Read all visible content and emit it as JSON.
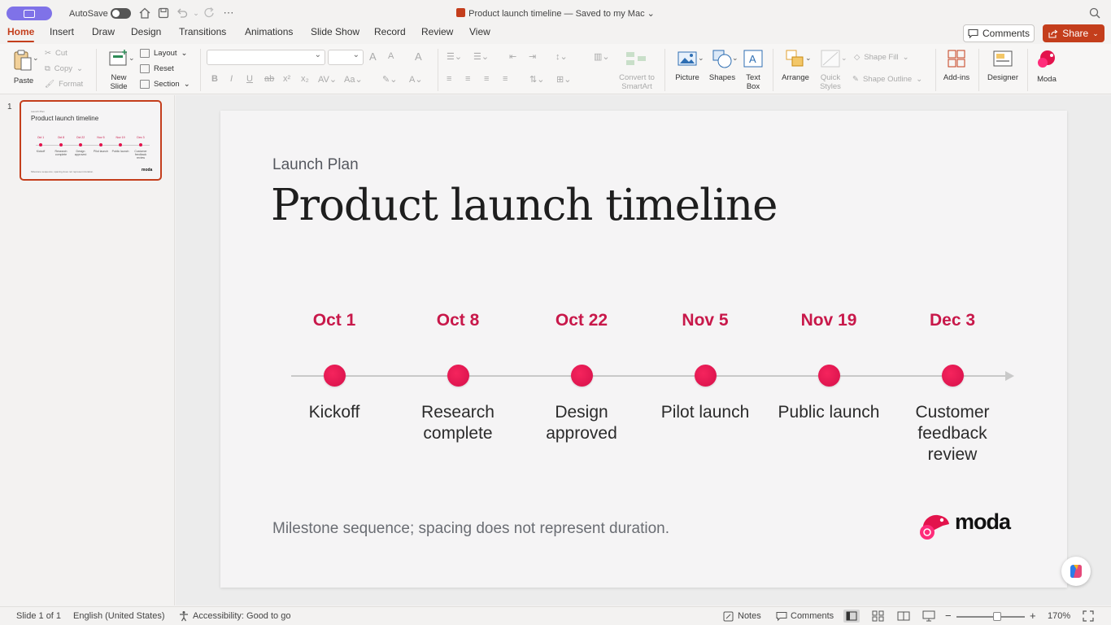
{
  "titlebar": {
    "autosave_label": "AutoSave",
    "doc_title": "Product launch timeline — Saved to my Mac ⌄"
  },
  "tabs": [
    "Home",
    "Insert",
    "Draw",
    "Design",
    "Transitions",
    "Animations",
    "Slide Show",
    "Record",
    "Review",
    "View"
  ],
  "header_buttons": {
    "comments": "Comments",
    "share": "Share"
  },
  "ribbon": {
    "paste": "Paste",
    "cut": "Cut",
    "copy": "Copy",
    "format": "Format",
    "new_slide_1": "New",
    "new_slide_2": "Slide",
    "layout": "Layout",
    "reset": "Reset",
    "section": "Section",
    "convert_1": "Convert to",
    "convert_2": "SmartArt",
    "picture": "Picture",
    "shapes": "Shapes",
    "text_box_1": "Text",
    "text_box_2": "Box",
    "arrange": "Arrange",
    "quick_styles_1": "Quick",
    "quick_styles_2": "Styles",
    "shape_fill": "Shape Fill",
    "shape_outline": "Shape Outline",
    "add_ins": "Add-ins",
    "designer": "Designer",
    "moda": "Moda"
  },
  "thumbnails": {
    "slide_number": "1"
  },
  "slide": {
    "eyebrow": "Launch Plan",
    "title": "Product launch timeline",
    "milestones": [
      {
        "date": "Oct 1",
        "label": "Kickoff"
      },
      {
        "date": "Oct 8",
        "label": "Research complete"
      },
      {
        "date": "Oct 22",
        "label": "Design approved"
      },
      {
        "date": "Nov 5",
        "label": "Pilot launch"
      },
      {
        "date": "Nov 19",
        "label": "Public launch"
      },
      {
        "date": "Dec 3",
        "label": "Customer feedback review"
      }
    ],
    "footnote": "Milestone sequence; spacing does not represent duration.",
    "logo_text": "moda",
    "accent_color": "#e3134c"
  },
  "statusbar": {
    "slide_of": "Slide 1 of 1",
    "language": "English (United States)",
    "accessibility": "Accessibility: Good to go",
    "notes": "Notes",
    "comments": "Comments",
    "zoom": "170%"
  }
}
